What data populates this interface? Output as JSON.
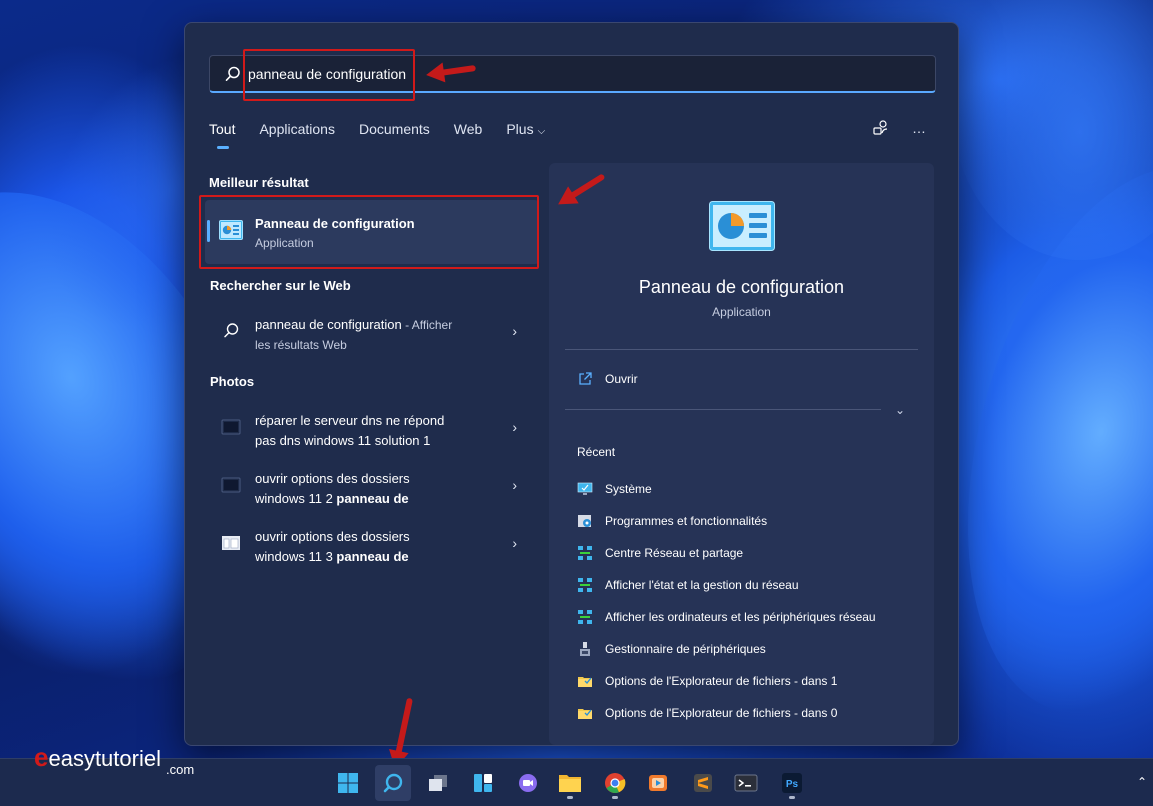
{
  "search": {
    "value": "panneau de configuration"
  },
  "tabs": [
    {
      "label": "Tout"
    },
    {
      "label": "Applications"
    },
    {
      "label": "Documents"
    },
    {
      "label": "Web"
    },
    {
      "label": "Plus"
    }
  ],
  "best_match": {
    "heading": "Meilleur résultat",
    "title": "Panneau de configuration",
    "subtitle": "Application"
  },
  "web": {
    "heading": "Rechercher sur le Web",
    "query": "panneau de configuration",
    "suffix": " - Afficher",
    "line2": "les résultats Web"
  },
  "photos": {
    "heading": "Photos",
    "items": [
      {
        "line1": "réparer le serveur dns ne répond",
        "line2": "pas dns windows 11 solution 1",
        "bold": ""
      },
      {
        "line1": "ouvrir options des dossiers",
        "line2": "windows 11 2 ",
        "bold": "panneau de"
      },
      {
        "line1": "ouvrir options des dossiers",
        "line2": "windows 11 3 ",
        "bold": "panneau de"
      }
    ]
  },
  "preview": {
    "title": "Panneau de configuration",
    "subtitle": "Application",
    "open_label": "Ouvrir",
    "recent_heading": "Récent",
    "recent": [
      {
        "label": "Système",
        "icon": "system-icon"
      },
      {
        "label": "Programmes et fonctionnalités",
        "icon": "programs-icon"
      },
      {
        "label": "Centre Réseau et partage",
        "icon": "network-icon"
      },
      {
        "label": "Afficher l'état et la gestion du réseau",
        "icon": "network-icon"
      },
      {
        "label": "Afficher les ordinateurs et les périphériques réseau",
        "icon": "network-icon"
      },
      {
        "label": "Gestionnaire de périphériques",
        "icon": "device-manager-icon"
      },
      {
        "label": "Options de l'Explorateur de fichiers - dans 1",
        "icon": "folder-options-icon"
      },
      {
        "label": "Options de l'Explorateur de fichiers - dans 0",
        "icon": "folder-options-icon"
      }
    ]
  },
  "watermark": {
    "brand": "easytutoriel",
    "tld": ".com"
  },
  "taskbar": {
    "apps": [
      "start-icon",
      "search-icon",
      "task-view-icon",
      "widgets-icon",
      "teams-chat-icon",
      "file-explorer-icon",
      "chrome-icon",
      "media-player-icon",
      "sublime-text-icon",
      "terminal-icon",
      "photoshop-icon"
    ]
  },
  "colors": {
    "accent": "#5ab0ff",
    "annotation_red": "#d11a1a"
  }
}
